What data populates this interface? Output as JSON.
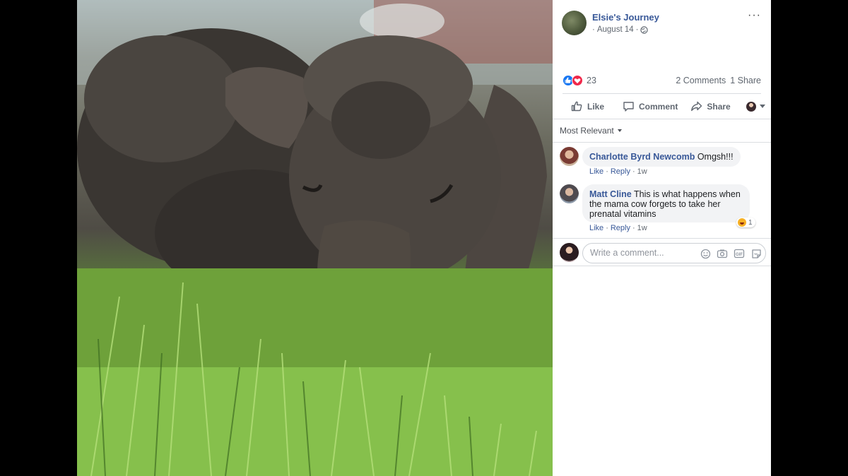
{
  "post": {
    "page_name": "Elsie's Journey",
    "date": "August 14",
    "meta_separator": "·",
    "more_label": "···",
    "reaction_count": "23",
    "comments_count": "2 Comments",
    "shares_count": "1 Share"
  },
  "actions": {
    "like": "Like",
    "comment": "Comment",
    "share": "Share"
  },
  "sort": {
    "label": "Most Relevant"
  },
  "comments": [
    {
      "author": "Charlotte Byrd Newcomb",
      "text": "Omgsh!!!",
      "like": "Like",
      "reply": "Reply",
      "time": "1w",
      "sep": "·"
    },
    {
      "author": "Matt Cline",
      "text": "This is what happens when the mama cow forgets to take her prenatal vitamins",
      "like": "Like",
      "reply": "Reply",
      "time": "1w",
      "sep": "·",
      "reaction": {
        "icon": "haha-icon",
        "count": "1"
      }
    }
  ],
  "composer": {
    "placeholder": "Write a comment..."
  },
  "colors": {
    "link": "#385898",
    "like_blue": "#1877f2",
    "love_red": "#f0284a"
  }
}
